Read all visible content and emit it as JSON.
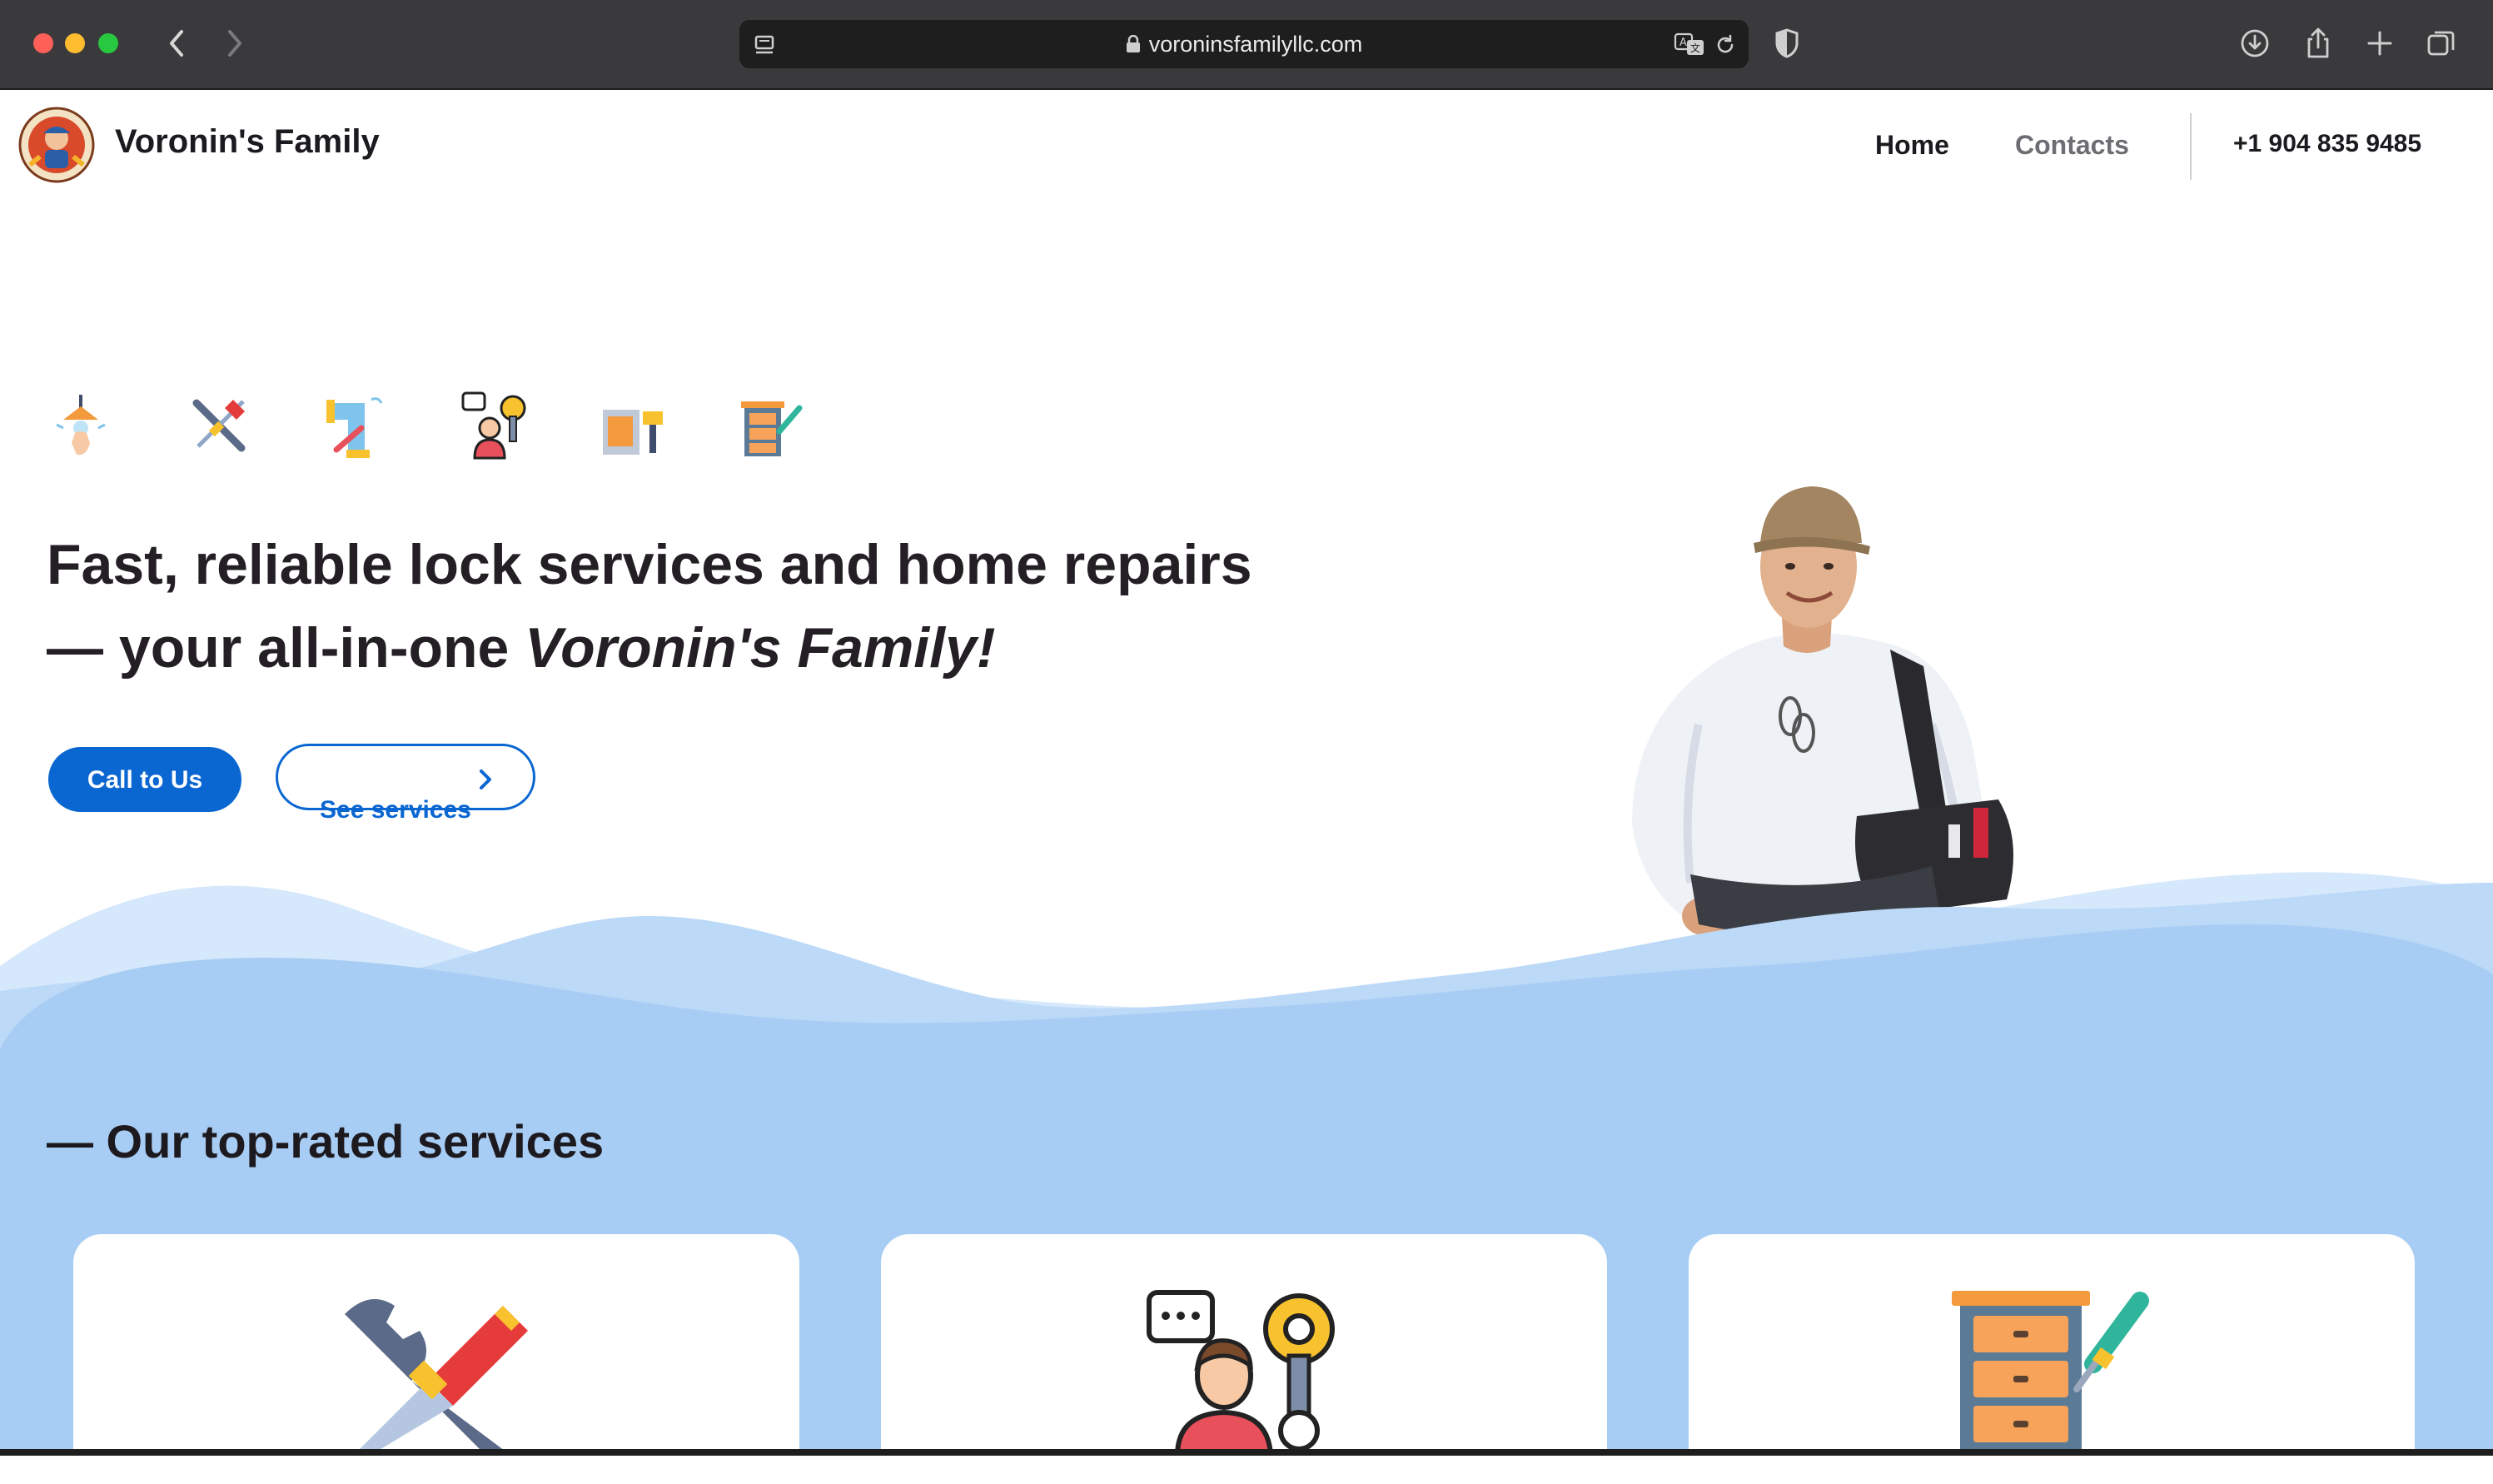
{
  "browser": {
    "url": "voroninsfamilyllc.com"
  },
  "header": {
    "brand": "Voronin's Family",
    "nav": {
      "home": "Home",
      "contacts": "Contacts",
      "phone": "+1 904 835 9485"
    }
  },
  "hero": {
    "title_line1": "Fast, reliable lock services and home repairs",
    "title_line2_prefix": "— your all-in-one ",
    "title_line2_em": "Voronin's Family!",
    "icons": [
      "ceiling-lamp-icon",
      "tools-icon",
      "plumbing-icon",
      "technician-icon",
      "paint-icon",
      "furniture-icon"
    ],
    "call_button": "Call to Us",
    "services_button": "See services"
  },
  "services": {
    "heading": "— Our top-rated services",
    "cards": [
      {
        "icon": "wrench-screwdriver-icon"
      },
      {
        "icon": "technician-icon"
      },
      {
        "icon": "dresser-screwdriver-icon"
      }
    ]
  },
  "colors": {
    "primary": "#0a66d1",
    "wave_light": "#d6e8fb",
    "wave_mid": "#bcd9f7",
    "wave_band": "#a8cdf4",
    "text": "#1d1a1f"
  }
}
